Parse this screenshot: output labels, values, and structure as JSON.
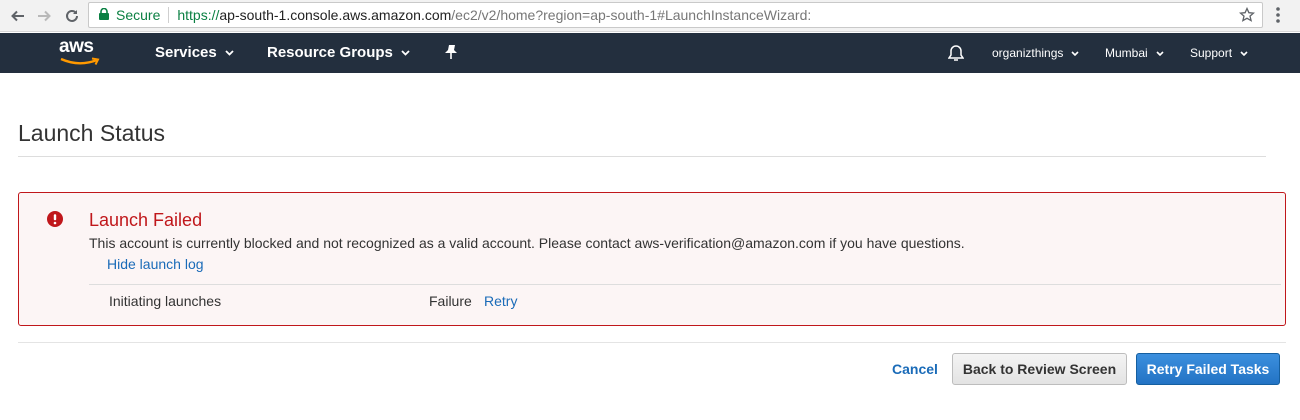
{
  "browser": {
    "secure_label": "Secure",
    "url_scheme": "https://",
    "url_host": "ap-south-1.console.aws.amazon.com",
    "url_path": "/ec2/v2/home?region=ap-south-1#LaunchInstanceWizard:",
    "icons": [
      "back-icon",
      "forward-icon",
      "reload-icon",
      "lock-icon",
      "star-icon",
      "menu-icon"
    ]
  },
  "nav": {
    "logo": "aws",
    "services": "Services",
    "resource_groups": "Resource Groups",
    "account": "organizthings",
    "region": "Mumbai",
    "support": "Support",
    "colors": {
      "bar": "#232f3e",
      "logo_smile": "#ff9900"
    }
  },
  "page": {
    "title": "Launch Status"
  },
  "alert": {
    "title": "Launch Failed",
    "message": "This account is currently blocked and not recognized as a valid account. Please contact aws-verification@amazon.com if you have questions.",
    "hide_log": "Hide launch log",
    "log": {
      "label": "Initiating launches",
      "status": "Failure",
      "retry": "Retry"
    },
    "colors": {
      "border": "#c0171b",
      "background": "#fcf5f5"
    }
  },
  "footer": {
    "cancel": "Cancel",
    "back": "Back to Review Screen",
    "retry_failed": "Retry Failed Tasks",
    "colors": {
      "primary": "#2373c4"
    }
  }
}
